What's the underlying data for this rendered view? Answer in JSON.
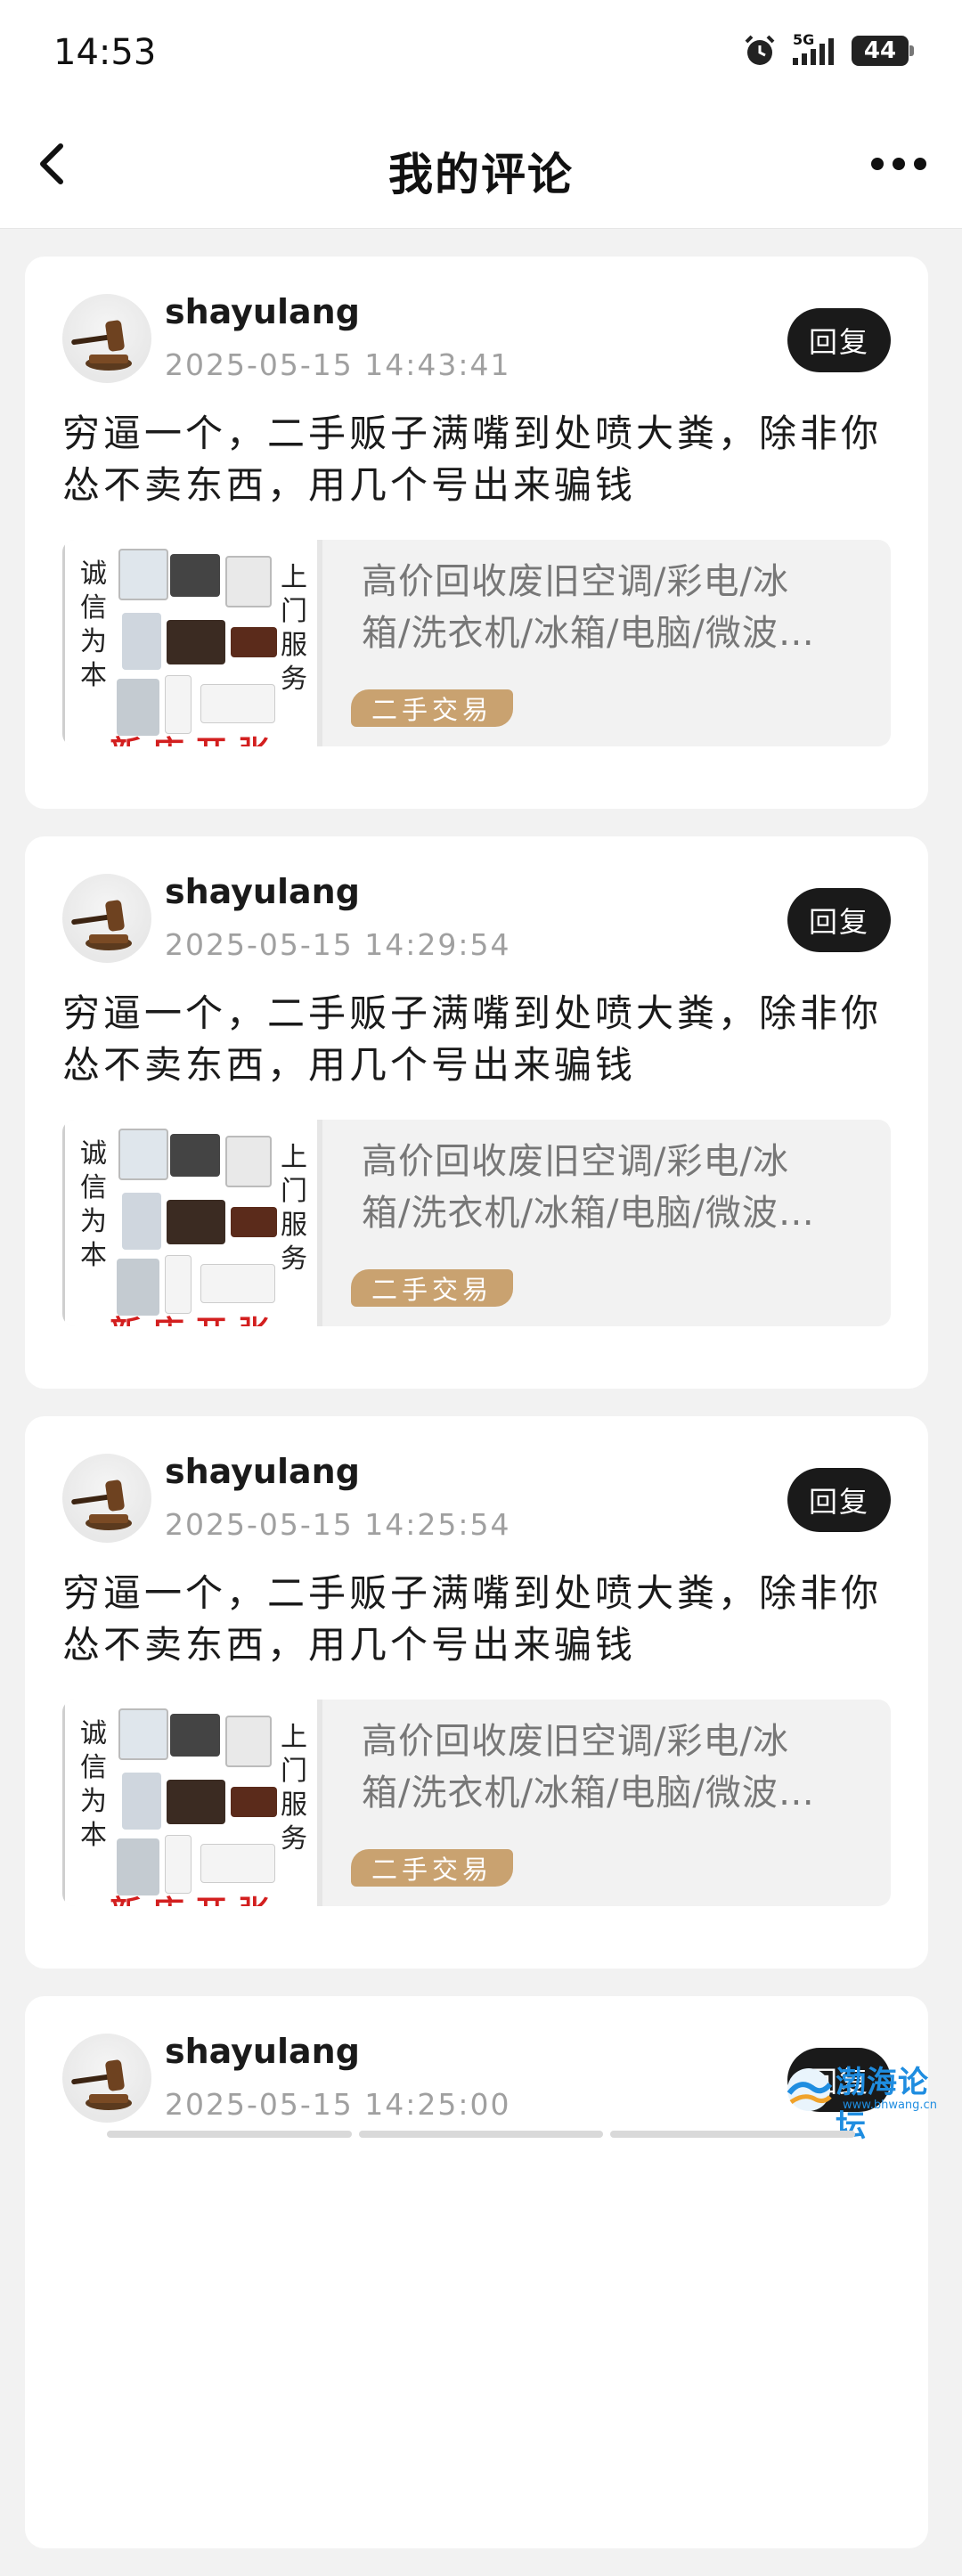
{
  "status_bar": {
    "time": "14:53",
    "network": "5G",
    "battery": "44"
  },
  "nav": {
    "title": "我的评论"
  },
  "comments": [
    {
      "username": "shayulang",
      "timestamp": "2025-05-15 14:43:41",
      "reply_label": "回复",
      "text": "穷逼一个，二手贩子满嘴到处喷大粪，除非你怂不卖东西，用几个号出来骗钱",
      "post": {
        "title_line1": "高价回收废旧空调/彩电/冰",
        "title_line2": "箱/洗衣机/冰箱/电脑/微波…",
        "category": "二手交易",
        "thumb_left": "诚信为本",
        "thumb_right": "上门服务",
        "thumb_bottom": "新店开张"
      }
    },
    {
      "username": "shayulang",
      "timestamp": "2025-05-15 14:29:54",
      "reply_label": "回复",
      "text": "穷逼一个，二手贩子满嘴到处喷大粪，除非你怂不卖东西，用几个号出来骗钱",
      "post": {
        "title_line1": "高价回收废旧空调/彩电/冰",
        "title_line2": "箱/洗衣机/冰箱/电脑/微波…",
        "category": "二手交易",
        "thumb_left": "诚信为本",
        "thumb_right": "上门服务",
        "thumb_bottom": "新店开张"
      }
    },
    {
      "username": "shayulang",
      "timestamp": "2025-05-15 14:25:54",
      "reply_label": "回复",
      "text": "穷逼一个，二手贩子满嘴到处喷大粪，除非你怂不卖东西，用几个号出来骗钱",
      "post": {
        "title_line1": "高价回收废旧空调/彩电/冰",
        "title_line2": "箱/洗衣机/冰箱/电脑/微波…",
        "category": "二手交易",
        "thumb_left": "诚信为本",
        "thumb_right": "上门服务",
        "thumb_bottom": "新店开张"
      }
    },
    {
      "username": "shayulang",
      "timestamp": "2025-05-15 14:25:00",
      "reply_label": "回复"
    }
  ],
  "watermark": {
    "brand": "渤海论坛",
    "url": "www.bhwang.cn"
  },
  "colors": {
    "reply_button": "#1a1a1a",
    "category_badge": "#c9a270",
    "background": "#f2f2f2"
  }
}
